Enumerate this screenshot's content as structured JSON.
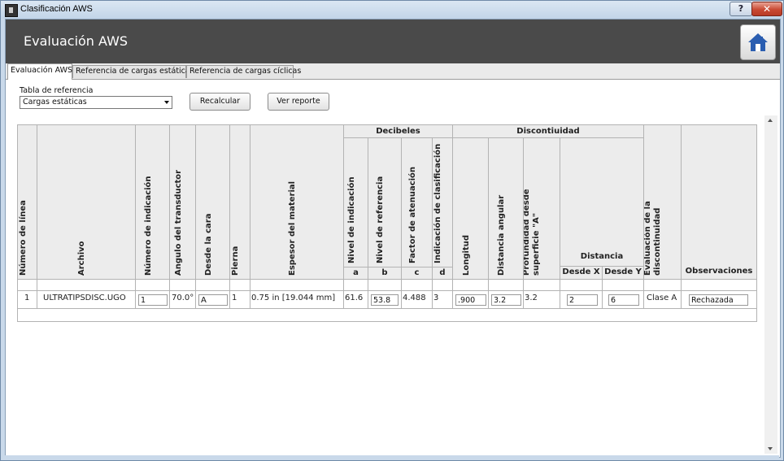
{
  "window": {
    "title": "Clasificación AWS",
    "help_glyph": "?",
    "close_glyph": "✕"
  },
  "header": {
    "title": "Evaluación AWS",
    "home_icon": "home-icon"
  },
  "tabs": [
    {
      "label": "Evaluación AWS",
      "active": true
    },
    {
      "label": "Referencia de cargas estáticas",
      "active": false
    },
    {
      "label": "Referencia de cargas cíclicas",
      "active": false
    }
  ],
  "reference": {
    "label": "Tabla de referencia",
    "selected": "Cargas estáticas"
  },
  "buttons": {
    "recalculate": "Recalcular",
    "report": "Ver reporte"
  },
  "table": {
    "group_headers": {
      "decibels": "Decibeles",
      "discontinuity": "Discontiuidad",
      "distance": "Distancia"
    },
    "columns": {
      "line_number": "Número de línea",
      "file": "Archivo",
      "indication_number": "Número de indicación",
      "transducer_angle": "Angulo del transductor",
      "from_face": "Desde la cara",
      "leg": "Pierna",
      "thickness": "Espesor del material",
      "indication_level": "Nivel de indicación",
      "reference_level": "Nivel de referencia",
      "attenuation_factor": "Factor de atenuación",
      "classification_indication": "Indicación de clasificación",
      "length": "Longitud",
      "angular_distance": "Distancia angular",
      "depth_from_surface": "Profundidad desde superficie \"A\"",
      "from_x": "Desde X",
      "from_y": "Desde Y",
      "discontinuity_eval": "Evaluación de la discontinuidad",
      "observations": "Observaciones"
    },
    "sub_labels": {
      "a": "a",
      "b": "b",
      "c": "c",
      "d": "d"
    },
    "rows": [
      {
        "line_number": "1",
        "file": "ULTRATIPSDISC.UGO",
        "indication_number": "1",
        "transducer_angle": "70.0°",
        "from_face": "A",
        "leg": "1",
        "thickness": "0.75 in [19.044 mm]",
        "indication_level": "61.6",
        "reference_level": "53.8",
        "attenuation_factor": "4.488",
        "classification_indication": "3",
        "length": ".900",
        "angular_distance": "3.2",
        "depth_from_surface": "3.2",
        "from_x": "2",
        "from_y": "6",
        "discontinuity_eval": "Clase A",
        "observations": "Rechazada"
      }
    ]
  }
}
